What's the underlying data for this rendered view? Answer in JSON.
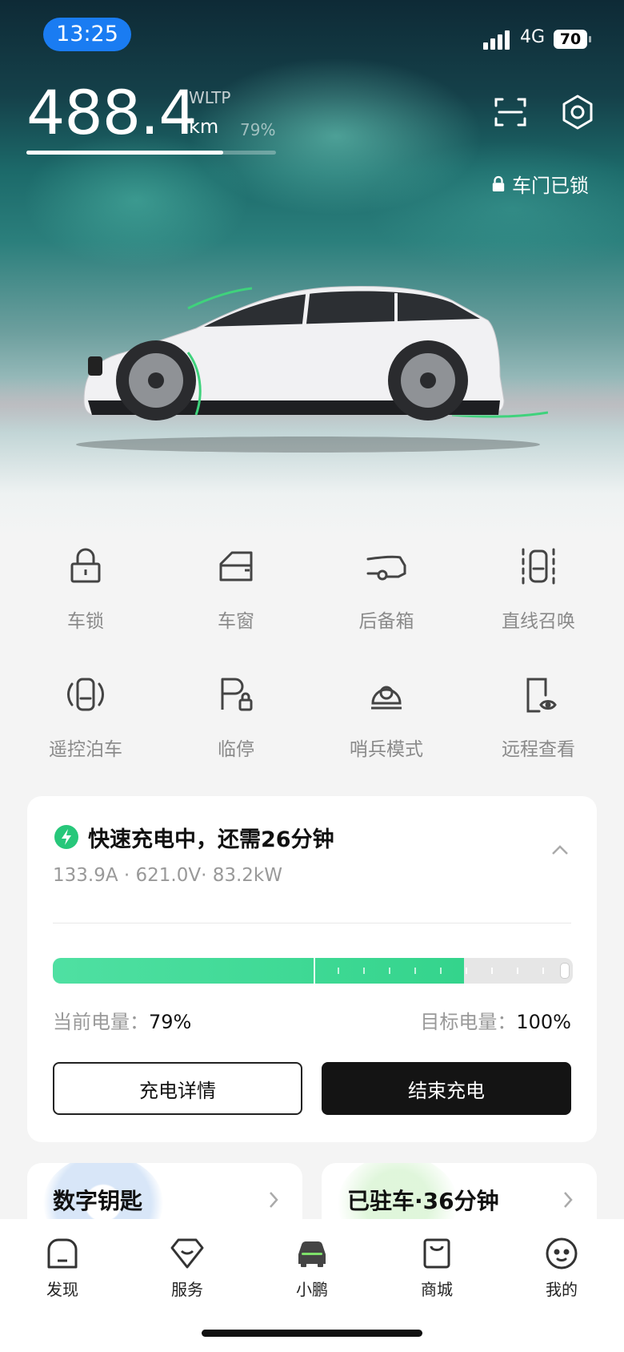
{
  "status_bar": {
    "time": "13:25",
    "network": "4G",
    "battery": "70"
  },
  "vehicle": {
    "range_value": "488.4",
    "range_standard": "WLTP",
    "range_unit": "km",
    "battery_percent_label": "79%",
    "battery_fraction": 0.79,
    "door_status": "车门已锁"
  },
  "controls": [
    {
      "label": "车锁",
      "icon": "lock-icon"
    },
    {
      "label": "车窗",
      "icon": "window-icon"
    },
    {
      "label": "后备箱",
      "icon": "trunk-icon"
    },
    {
      "label": "直线召唤",
      "icon": "summon-icon"
    },
    {
      "label": "遥控泊车",
      "icon": "remote-parking-icon"
    },
    {
      "label": "临停",
      "icon": "temporary-parking-icon"
    },
    {
      "label": "哨兵模式",
      "icon": "sentry-icon"
    },
    {
      "label": "远程查看",
      "icon": "remote-view-icon"
    }
  ],
  "charging": {
    "title": "快速充电中，还需26分钟",
    "details": "133.9A · 621.0V· 83.2kW",
    "current_label": "当前电量：",
    "current_value": "79%",
    "current_fraction": 0.79,
    "target_label": "目标电量：",
    "target_value": "100%",
    "details_button": "充电详情",
    "stop_button": "结束充电",
    "accent_color": "#34d48c"
  },
  "cards": {
    "digital_key": "数字钥匙",
    "parked": "已驻车·36分钟"
  },
  "tabs": [
    {
      "label": "发现",
      "icon": "discover-icon"
    },
    {
      "label": "服务",
      "icon": "service-icon"
    },
    {
      "label": "小鹏",
      "icon": "car-icon"
    },
    {
      "label": "商城",
      "icon": "shop-icon"
    },
    {
      "label": "我的",
      "icon": "profile-icon"
    }
  ]
}
